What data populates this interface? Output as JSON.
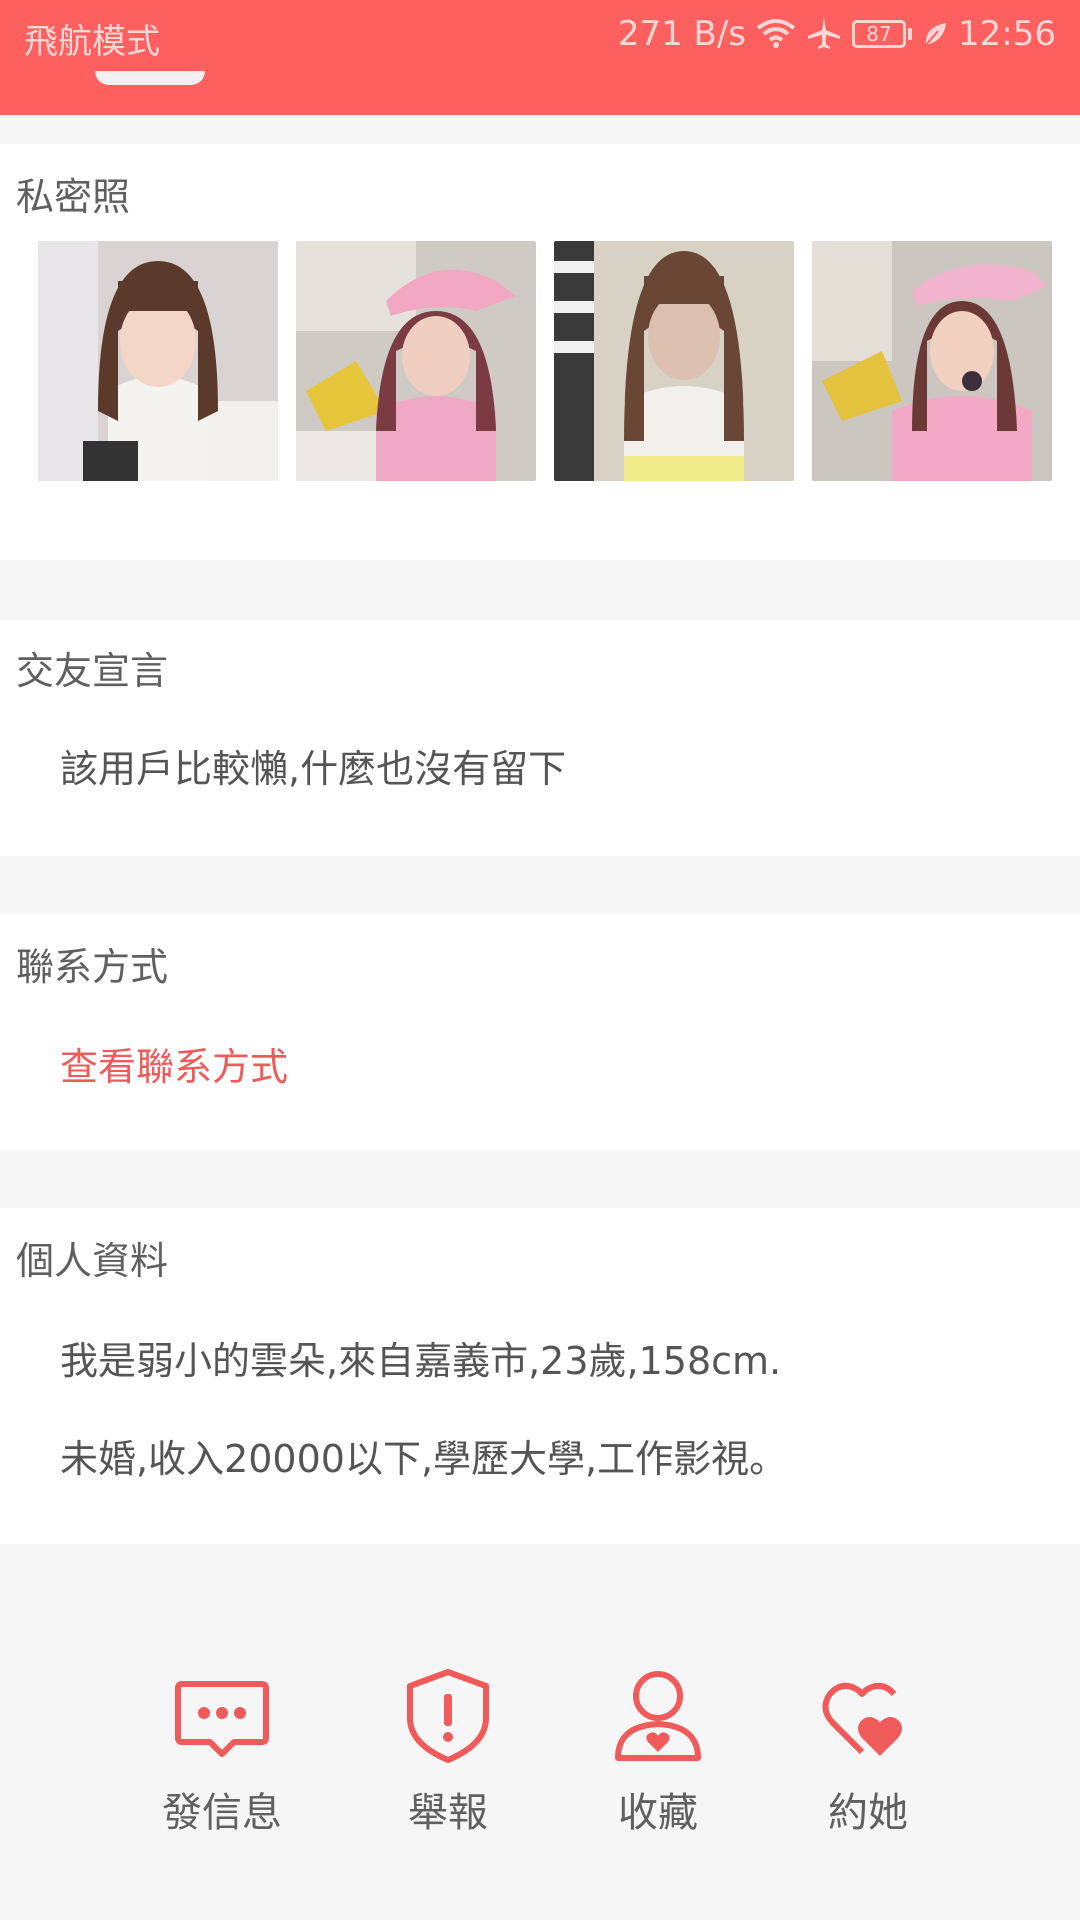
{
  "status_bar": {
    "mode": "飛航模式",
    "speed": "271 B/s",
    "battery": "87",
    "time": "12:56"
  },
  "private_photos": {
    "title": "私密照",
    "photos": [
      "photo-1",
      "photo-2",
      "photo-3",
      "photo-4"
    ]
  },
  "declaration": {
    "title": "交友宣言",
    "text": "該用戶比較懶,什麼也沒有留下"
  },
  "contact": {
    "title": "聯系方式",
    "link": "查看聯系方式"
  },
  "profile": {
    "title": "個人資料",
    "line1": "我是弱小的雲朵,來自嘉義市,23歲,158cm.",
    "line2": "未婚,收入20000以下,學歷大學,工作影視。"
  },
  "actions": [
    {
      "label": "發信息",
      "icon": "message-icon"
    },
    {
      "label": "舉報",
      "icon": "report-shield-icon"
    },
    {
      "label": "收藏",
      "icon": "favorite-user-icon"
    },
    {
      "label": "約她",
      "icon": "date-hearts-icon"
    }
  ],
  "colors": {
    "accent": "#fe5f5f",
    "link": "#ef5a5a",
    "background": "#f6f6f6"
  }
}
